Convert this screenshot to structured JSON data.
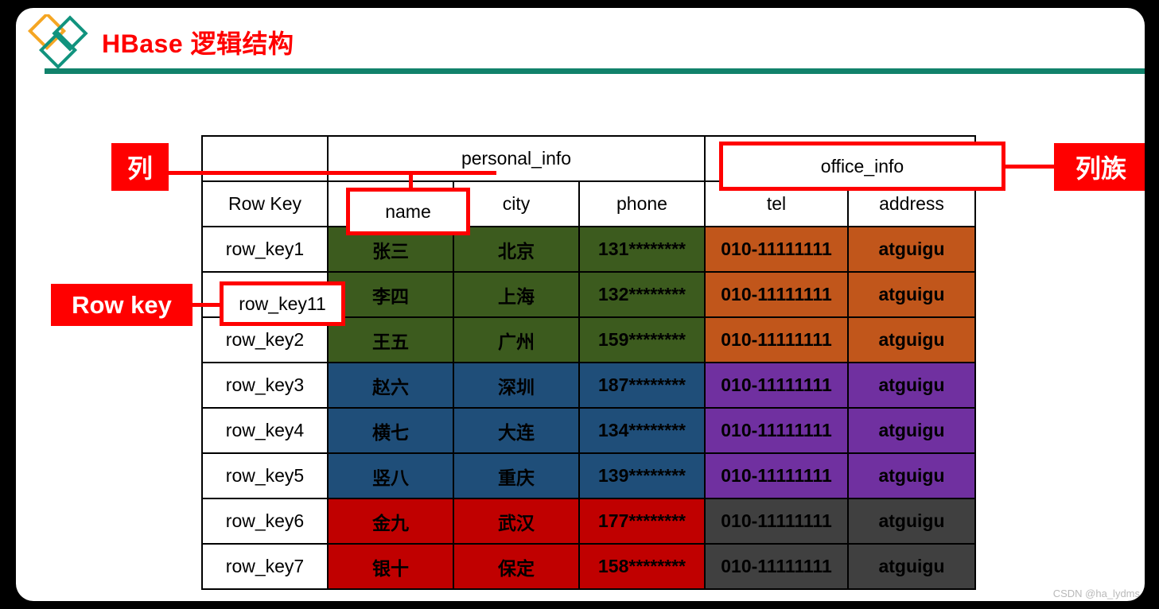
{
  "slide": {
    "title": "HBase 逻辑结构",
    "title_color": "#FF0000",
    "accent_color": "#11826B",
    "logo_colors": {
      "orange": "#F5A623",
      "teal": "#11937E"
    }
  },
  "annotations": [
    {
      "id": "column",
      "label": "列",
      "target": "name"
    },
    {
      "id": "column-family",
      "label": "列族",
      "target": "office_info"
    },
    {
      "id": "row-key",
      "label": "Row key",
      "target": "row_key11"
    }
  ],
  "table": {
    "group_headers": [
      {
        "label": "",
        "span": 1
      },
      {
        "label": "personal_info",
        "span": 3
      },
      {
        "label": "office_info",
        "span": 2
      }
    ],
    "columns": [
      "Row Key",
      "name",
      "city",
      "phone",
      "tel",
      "address"
    ],
    "rows": [
      {
        "row_key": "row_key1",
        "name": "张三",
        "city": "北京",
        "phone": "131********",
        "tel": "010-11111111",
        "address": "atguigu",
        "personal_color": "bg-green",
        "office_color": "bg-orange"
      },
      {
        "row_key": "row_key11",
        "name": "李四",
        "city": "上海",
        "phone": "132********",
        "tel": "010-11111111",
        "address": "atguigu",
        "personal_color": "bg-green",
        "office_color": "bg-orange"
      },
      {
        "row_key": "row_key2",
        "name": "王五",
        "city": "广州",
        "phone": "159********",
        "tel": "010-11111111",
        "address": "atguigu",
        "personal_color": "bg-green",
        "office_color": "bg-orange"
      },
      {
        "row_key": "row_key3",
        "name": "赵六",
        "city": "深圳",
        "phone": "187********",
        "tel": "010-11111111",
        "address": "atguigu",
        "personal_color": "bg-blue",
        "office_color": "bg-purple"
      },
      {
        "row_key": "row_key4",
        "name": "横七",
        "city": "大连",
        "phone": "134********",
        "tel": "010-11111111",
        "address": "atguigu",
        "personal_color": "bg-blue",
        "office_color": "bg-purple"
      },
      {
        "row_key": "row_key5",
        "name": "竖八",
        "city": "重庆",
        "phone": "139********",
        "tel": "010-11111111",
        "address": "atguigu",
        "personal_color": "bg-blue",
        "office_color": "bg-purple"
      },
      {
        "row_key": "row_key6",
        "name": "金九",
        "city": "武汉",
        "phone": "177********",
        "tel": "010-11111111",
        "address": "atguigu",
        "personal_color": "bg-red",
        "office_color": "bg-gray"
      },
      {
        "row_key": "row_key7",
        "name": "银十",
        "city": "保定",
        "phone": "158********",
        "tel": "010-11111111",
        "address": "atguigu",
        "personal_color": "bg-red",
        "office_color": "bg-gray"
      }
    ],
    "cell_colors": {
      "green": "#3C5B1E",
      "blue": "#1F4E79",
      "red": "#C00000",
      "orange": "#C1561B",
      "purple": "#7030A0",
      "gray": "#404040"
    }
  },
  "highlights": {
    "name_label": "name",
    "office_label": "office_info",
    "rowkey_label": "row_key11"
  },
  "watermark": "CSDN @ha_lydms"
}
